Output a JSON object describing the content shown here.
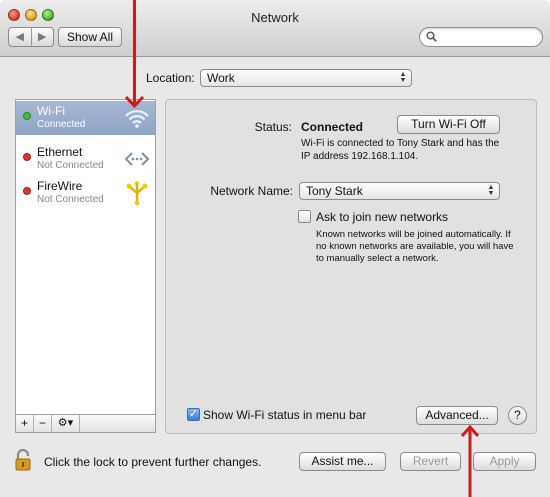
{
  "window": {
    "title": "Network"
  },
  "toolbar": {
    "back_glyph": "◀",
    "forward_glyph": "▶",
    "show_all_label": "Show All",
    "search_value": ""
  },
  "location": {
    "label": "Location:",
    "value": "Work"
  },
  "services": [
    {
      "name": "Wi-Fi",
      "status": "Connected",
      "status_color": "#3fbf3a",
      "icon": "wifi-icon",
      "selected": true
    },
    {
      "name": "Ethernet",
      "status": "Not Connected",
      "status_color": "#e0342a",
      "icon": "ethernet-icon",
      "selected": false
    },
    {
      "name": "FireWire",
      "status": "Not Connected",
      "status_color": "#e0342a",
      "icon": "firewire-icon",
      "selected": false
    }
  ],
  "sidebar_bar": {
    "add": "+",
    "remove": "−",
    "gear": "⚙▾"
  },
  "detail": {
    "status_label": "Status:",
    "status_value": "Connected",
    "wifi_off_button": "Turn Wi-Fi Off",
    "status_desc": "Wi-Fi is connected to Tony Stark and has the IP address 192.168.1.104.",
    "network_name_label": "Network Name:",
    "network_name_value": "Tony Stark",
    "ask_label": "Ask to join new networks",
    "ask_checked": false,
    "ask_desc": "Known networks will be joined automatically. If no known networks are available, you will have to manually select a network.",
    "menubar_label": "Show Wi-Fi status in menu bar",
    "menubar_checked": true,
    "advanced_button": "Advanced...",
    "help_button": "?"
  },
  "footer": {
    "lock_text": "Click the lock to prevent further changes.",
    "assist_button": "Assist me...",
    "revert_button": "Revert",
    "apply_button": "Apply"
  },
  "colors": {
    "annotation_arrow": "#cc1b1b",
    "selection": "#8fa4c6"
  }
}
